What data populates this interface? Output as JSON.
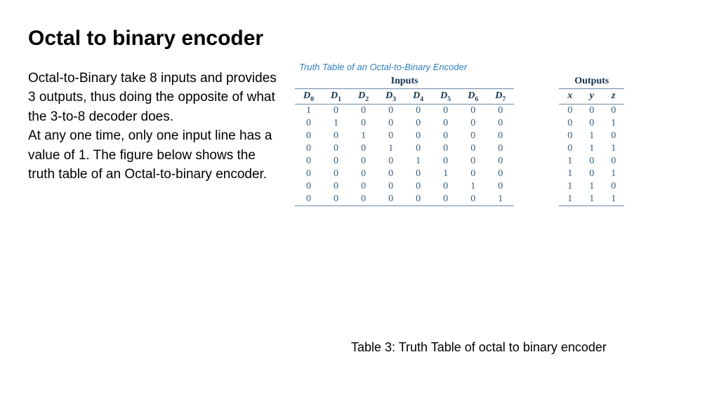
{
  "title": "Octal to binary encoder",
  "body_p1": "Octal-to-Binary take 8 inputs and provides 3 outputs,  thus doing the opposite of what the 3-to-8 decoder does.",
  "body_p2": "At any one time, only one input line has a value of 1. The figure below shows the truth table of an Octal-to-binary encoder.",
  "tt_caption": "Truth Table of an Octal-to-Binary Encoder",
  "group_inputs": "Inputs",
  "group_outputs": "Outputs",
  "input_headers": [
    "D0",
    "D1",
    "D2",
    "D3",
    "D4",
    "D5",
    "D6",
    "D7"
  ],
  "output_headers": [
    "x",
    "y",
    "z"
  ],
  "fig_caption": "Table 3: Truth Table of octal to binary encoder",
  "chart_data": {
    "type": "table",
    "title": "Truth Table of an Octal-to-Binary Encoder",
    "columns_in": [
      "D0",
      "D1",
      "D2",
      "D3",
      "D4",
      "D5",
      "D6",
      "D7"
    ],
    "columns_out": [
      "x",
      "y",
      "z"
    ],
    "rows": [
      {
        "in": [
          1,
          0,
          0,
          0,
          0,
          0,
          0,
          0
        ],
        "out": [
          0,
          0,
          0
        ]
      },
      {
        "in": [
          0,
          1,
          0,
          0,
          0,
          0,
          0,
          0
        ],
        "out": [
          0,
          0,
          1
        ]
      },
      {
        "in": [
          0,
          0,
          1,
          0,
          0,
          0,
          0,
          0
        ],
        "out": [
          0,
          1,
          0
        ]
      },
      {
        "in": [
          0,
          0,
          0,
          1,
          0,
          0,
          0,
          0
        ],
        "out": [
          0,
          1,
          1
        ]
      },
      {
        "in": [
          0,
          0,
          0,
          0,
          1,
          0,
          0,
          0
        ],
        "out": [
          1,
          0,
          0
        ]
      },
      {
        "in": [
          0,
          0,
          0,
          0,
          0,
          1,
          0,
          0
        ],
        "out": [
          1,
          0,
          1
        ]
      },
      {
        "in": [
          0,
          0,
          0,
          0,
          0,
          0,
          1,
          0
        ],
        "out": [
          1,
          1,
          0
        ]
      },
      {
        "in": [
          0,
          0,
          0,
          0,
          0,
          0,
          0,
          1
        ],
        "out": [
          1,
          1,
          1
        ]
      }
    ]
  }
}
